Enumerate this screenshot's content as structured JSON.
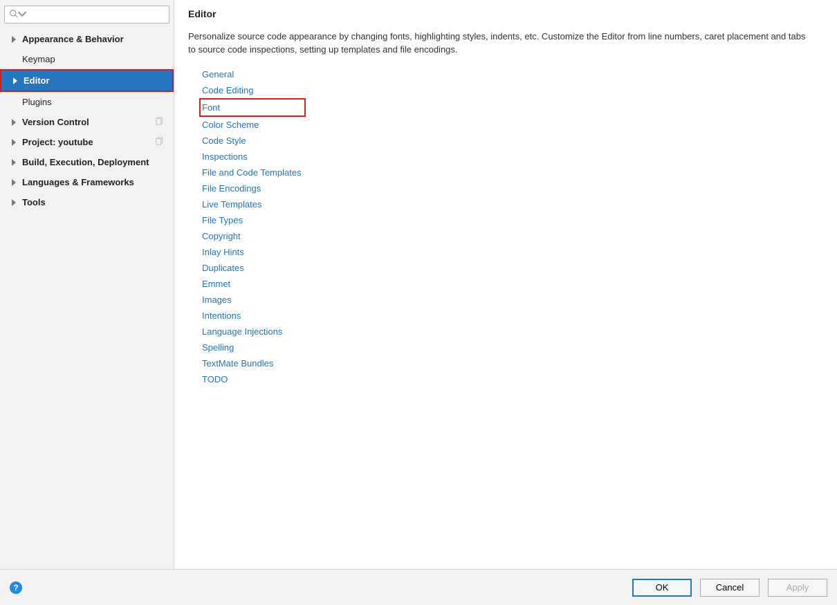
{
  "search": {
    "placeholder": ""
  },
  "sidebar": {
    "items": [
      {
        "label": "Appearance & Behavior",
        "expandable": true,
        "selected": false,
        "highlight": false
      },
      {
        "label": "Keymap",
        "expandable": false,
        "selected": false,
        "highlight": false
      },
      {
        "label": "Editor",
        "expandable": true,
        "selected": true,
        "highlight": true
      },
      {
        "label": "Plugins",
        "expandable": false,
        "selected": false,
        "highlight": false
      },
      {
        "label": "Version Control",
        "expandable": true,
        "selected": false,
        "highlight": false,
        "project": true
      },
      {
        "label": "Project: youtube",
        "expandable": true,
        "selected": false,
        "highlight": false,
        "project": true
      },
      {
        "label": "Build, Execution, Deployment",
        "expandable": true,
        "selected": false,
        "highlight": false
      },
      {
        "label": "Languages & Frameworks",
        "expandable": true,
        "selected": false,
        "highlight": false
      },
      {
        "label": "Tools",
        "expandable": true,
        "selected": false,
        "highlight": false
      }
    ]
  },
  "main": {
    "title": "Editor",
    "description": "Personalize source code appearance by changing fonts, highlighting styles, indents, etc. Customize the Editor from line numbers, caret placement and tabs to source code inspections, setting up templates and file encodings.",
    "links": [
      "General",
      "Code Editing",
      "Font",
      "Color Scheme",
      "Code Style",
      "Inspections",
      "File and Code Templates",
      "File Encodings",
      "Live Templates",
      "File Types",
      "Copyright",
      "Inlay Hints",
      "Duplicates",
      "Emmet",
      "Images",
      "Intentions",
      "Language Injections",
      "Spelling",
      "TextMate Bundles",
      "TODO"
    ],
    "highlight_link_index": 2
  },
  "footer": {
    "help_label": "?",
    "ok": "OK",
    "cancel": "Cancel",
    "apply": "Apply"
  }
}
